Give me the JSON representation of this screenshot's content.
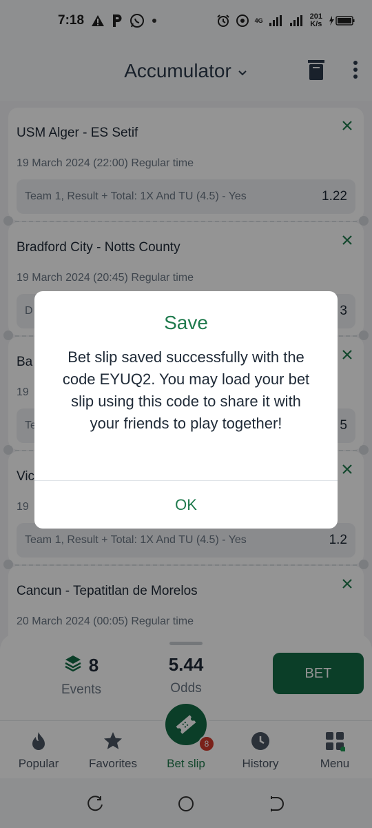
{
  "status_bar": {
    "time": "7:18",
    "net_speed_top": "201",
    "net_speed_bottom": "K/s",
    "network": "4G"
  },
  "header": {
    "title": "Accumulator"
  },
  "bets": [
    {
      "teams": "USM Alger - ES Setif",
      "date": "19 March 2024 (22:00) Regular time",
      "pick": "Team 1, Result + Total: 1X And TU (4.5) - Yes",
      "odd": "1.22"
    },
    {
      "teams": "Bradford City - Notts County",
      "date": "19 March 2024 (20:45) Regular time",
      "pick": "D",
      "odd": "3"
    },
    {
      "teams": "Ba",
      "date": "19",
      "pick": "Te",
      "odd": "5"
    },
    {
      "teams": "Vic",
      "date": "19",
      "pick": "Team 1, Result + Total: 1X And TU (4.5) - Yes",
      "odd": "1.2"
    },
    {
      "teams": "Cancun - Tepatitlan de Morelos",
      "date": "20 March 2024 (00:05) Regular time"
    }
  ],
  "summary": {
    "events_count": "8",
    "events_label": "Events",
    "odds_value": "5.44",
    "odds_label": "Odds",
    "bet_label": "BET"
  },
  "nav": {
    "popular": "Popular",
    "favorites": "Favorites",
    "bet_slip": "Bet slip",
    "bet_slip_badge": "8",
    "history": "History",
    "menu": "Menu"
  },
  "dialog": {
    "title": "Save",
    "message": "Bet slip saved successfully with the code EYUQ2. You may load your bet slip using this code to share it with your friends to play together!",
    "ok_label": "OK"
  },
  "colors": {
    "accent": "#1f7a4d",
    "bet_button": "#136b45",
    "badge": "#d23a2c"
  }
}
